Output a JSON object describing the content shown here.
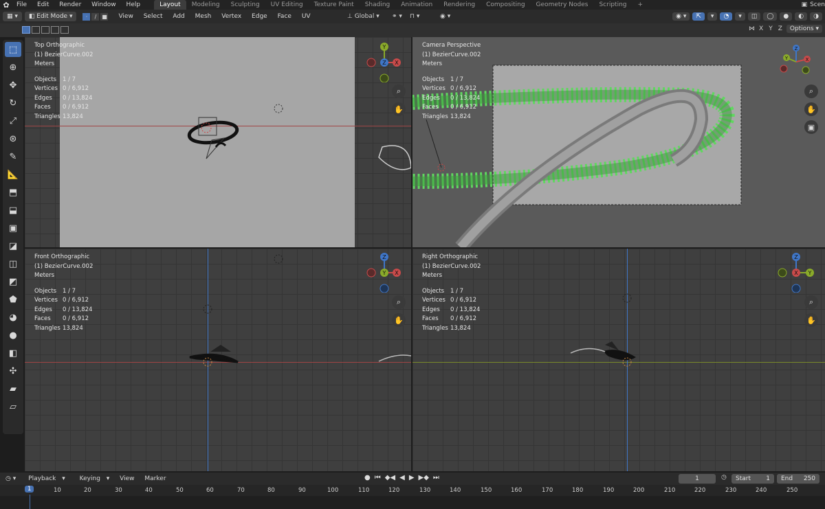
{
  "menu": {
    "items": [
      "File",
      "Edit",
      "Render",
      "Window",
      "Help"
    ],
    "workspaces": [
      "Layout",
      "Modeling",
      "Sculpting",
      "UV Editing",
      "Texture Paint",
      "Shading",
      "Animation",
      "Rendering",
      "Compositing",
      "Geometry Nodes",
      "Scripting"
    ],
    "active_workspace": "Layout",
    "scene_label": "Scen"
  },
  "header": {
    "mode": "Edit Mode",
    "menus": [
      "View",
      "Select",
      "Add",
      "Mesh",
      "Vertex",
      "Edge",
      "Face",
      "UV"
    ],
    "transform_orientation": "Global",
    "options_label": "Options",
    "axes": [
      "X",
      "Y",
      "Z"
    ]
  },
  "viewports": [
    {
      "view": "Top Orthographic",
      "object": "(1) BezierCurve.002",
      "units": "Meters",
      "stats": {
        "Objects": "1 / 7",
        "Vertices": "0 / 6,912",
        "Edges": "0 / 13,824",
        "Faces": "0 / 6,912",
        "Triangles": "13,824"
      }
    },
    {
      "view": "Camera Perspective",
      "object": "(1) BezierCurve.002",
      "units": "Meters",
      "stats": {
        "Objects": "1 / 7",
        "Vertices": "0 / 6,912",
        "Edges": "0 / 13,824",
        "Faces": "0 / 6,912",
        "Triangles": "13,824"
      }
    },
    {
      "view": "Front Orthographic",
      "object": "(1) BezierCurve.002",
      "units": "Meters",
      "stats": {
        "Objects": "1 / 7",
        "Vertices": "0 / 6,912",
        "Edges": "0 / 13,824",
        "Faces": "0 / 6,912",
        "Triangles": "13,824"
      }
    },
    {
      "view": "Right Orthographic",
      "object": "(1) BezierCurve.002",
      "units": "Meters",
      "stats": {
        "Objects": "1 / 7",
        "Vertices": "0 / 6,912",
        "Edges": "0 / 13,824",
        "Faces": "0 / 6,912",
        "Triangles": "13,824"
      }
    }
  ],
  "stat_labels": [
    "Objects",
    "Vertices",
    "Edges",
    "Faces",
    "Triangles"
  ],
  "gizmo_labels": {
    "x": "X",
    "y": "Y",
    "z": "Z"
  },
  "timeline": {
    "menus": [
      "Playback",
      "Keying",
      "View",
      "Marker"
    ],
    "current_frame": "1",
    "start_label": "Start",
    "start": "1",
    "end_label": "End",
    "end": "250",
    "ruler": [
      "10",
      "20",
      "30",
      "40",
      "50",
      "60",
      "70",
      "80",
      "90",
      "100",
      "110",
      "120",
      "130",
      "140",
      "150",
      "160",
      "170",
      "180",
      "190",
      "200",
      "210",
      "220",
      "230",
      "240",
      "250"
    ],
    "ruler_current": "1"
  },
  "colors": {
    "accent": "#4772b3",
    "x_axis": "#c84a4a",
    "y_axis": "#8aaa2a",
    "z_axis": "#3f76c8",
    "mesh_green": "#5fd85f"
  },
  "icons": [
    "blender-logo",
    "select-box-icon",
    "cursor-icon",
    "move-icon",
    "rotate-icon",
    "scale-icon",
    "transform-icon",
    "annotate-icon",
    "measure-icon",
    "add-cube-icon",
    "extrude-icon",
    "inset-icon",
    "bevel-icon",
    "loop-cut-icon",
    "knife-icon",
    "poly-build-icon",
    "spin-icon",
    "smooth-icon",
    "shrink-fatten-icon",
    "shear-icon",
    "rip-icon",
    "zoom-icon",
    "hand-icon",
    "camera-icon"
  ]
}
